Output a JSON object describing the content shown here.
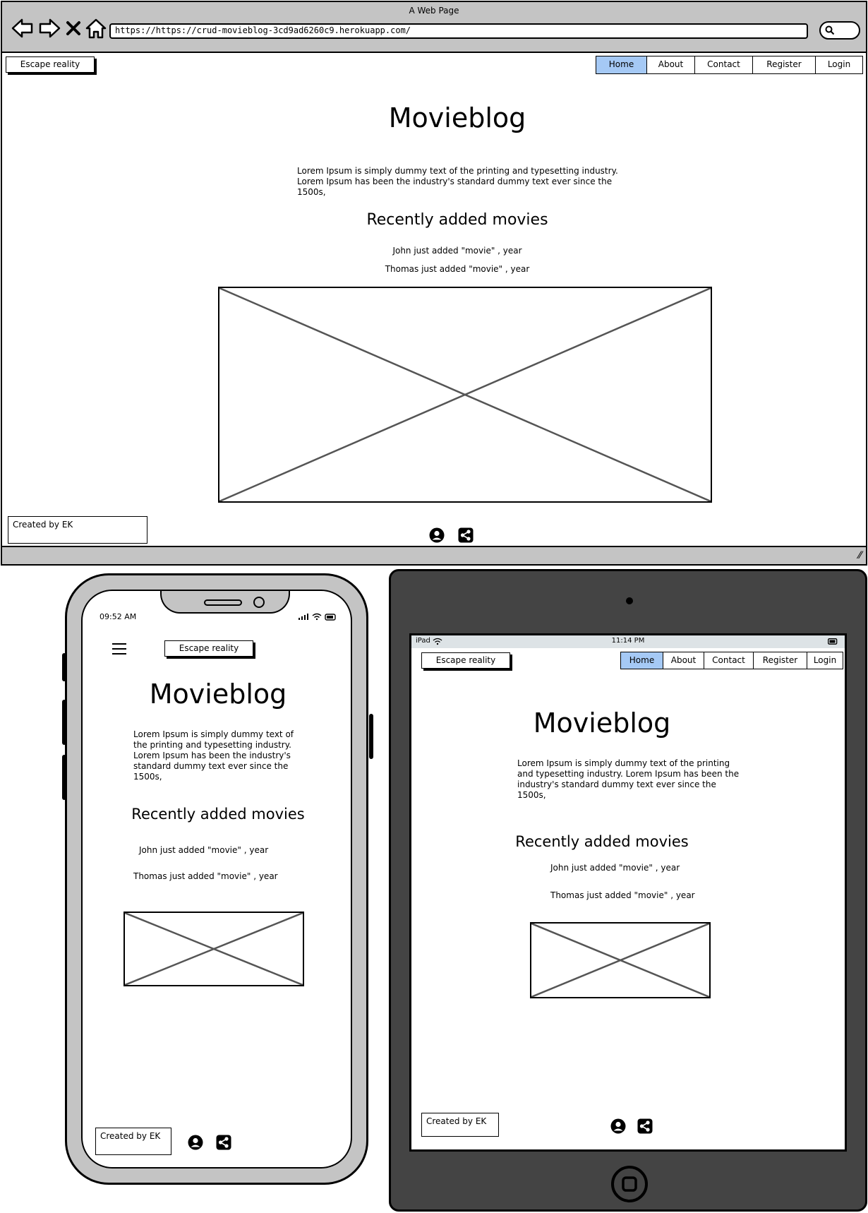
{
  "browser": {
    "window_title": "A Web Page",
    "url": "https://https://crud-movieblog-3cd9ad6260c9.herokuapp.com/"
  },
  "site": {
    "brand": "Escape reality",
    "nav": [
      "Home",
      "About",
      "Contact",
      "Register",
      "Login"
    ],
    "active_nav": "Home",
    "title": "Movieblog",
    "intro": "Lorem Ipsum is simply dummy text of the printing and typesetting industry. Lorem Ipsum has been the industry's standard dummy text ever since the 1500s,",
    "recent_heading": "Recently added movies",
    "recent": [
      "John just added \"movie\" , year",
      "Thomas just added \"movie\" , year"
    ],
    "footer": "Created by EK"
  },
  "phone": {
    "time": "09:52 AM"
  },
  "tablet": {
    "device": "iPad",
    "time": "11:14 PM"
  },
  "icons": {
    "back": "back-arrow-icon",
    "forward": "forward-arrow-icon",
    "close": "close-icon",
    "home": "home-icon",
    "search": "search-icon",
    "user": "user-icon",
    "share": "share-icon",
    "menu": "hamburger-menu-icon"
  },
  "colors": {
    "active_nav": "#a5c9f5",
    "chrome": "#c4c4c4",
    "tablet_body": "#444444"
  }
}
